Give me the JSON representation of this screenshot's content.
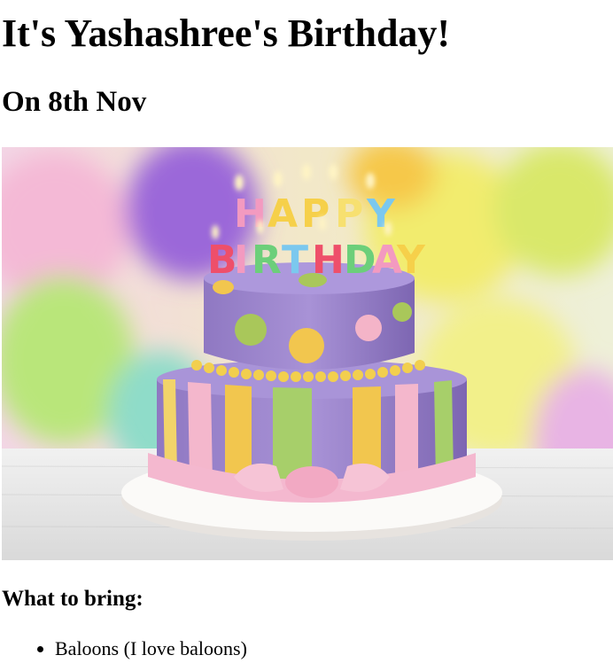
{
  "page": {
    "title": "It's Yashashree's Birthday!",
    "date": "On 8th Nov"
  },
  "image": {
    "description_icon": "birthday-cake-photo",
    "candles_top": "HAPPY",
    "candles_bottom": "BIRTHDAY"
  },
  "bring": {
    "heading": "What to bring:",
    "items": [
      "Baloons (I love baloons)"
    ]
  }
}
